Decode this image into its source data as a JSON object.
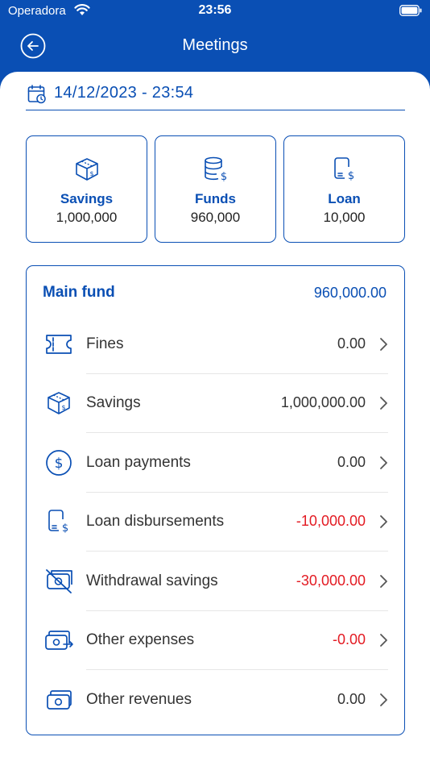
{
  "status_bar": {
    "carrier": "Operadora",
    "time": "23:56"
  },
  "nav": {
    "title": "Meetings"
  },
  "date_field": {
    "value": "14/12/2023 - 23:54"
  },
  "summary": [
    {
      "label": "Savings",
      "value": "1,000,000",
      "icon": "savings-box-icon"
    },
    {
      "label": "Funds",
      "value": "960,000",
      "icon": "coins-stack-icon"
    },
    {
      "label": "Loan",
      "value": "10,000",
      "icon": "loan-device-icon"
    }
  ],
  "main_fund": {
    "title": "Main fund",
    "value": "960,000.00",
    "rows": [
      {
        "label": "Fines",
        "amount": "0.00",
        "negative": false,
        "icon": "ticket-icon"
      },
      {
        "label": "Savings",
        "amount": "1,000,000.00",
        "negative": false,
        "icon": "savings-box-icon"
      },
      {
        "label": "Loan payments",
        "amount": "0.00",
        "negative": false,
        "icon": "dollar-circle-icon"
      },
      {
        "label": "Loan disbursements",
        "amount": "-10,000.00",
        "negative": true,
        "icon": "loan-device-icon"
      },
      {
        "label": "Withdrawal savings",
        "amount": "-30,000.00",
        "negative": true,
        "icon": "no-cash-icon"
      },
      {
        "label": "Other expenses",
        "amount": "-0.00",
        "negative": true,
        "icon": "cash-out-icon"
      },
      {
        "label": "Other revenues",
        "amount": "0.00",
        "negative": false,
        "icon": "cash-icon"
      }
    ]
  },
  "colors": {
    "primary": "#0a4fb4",
    "negative": "#e31b23",
    "text": "#333333"
  }
}
